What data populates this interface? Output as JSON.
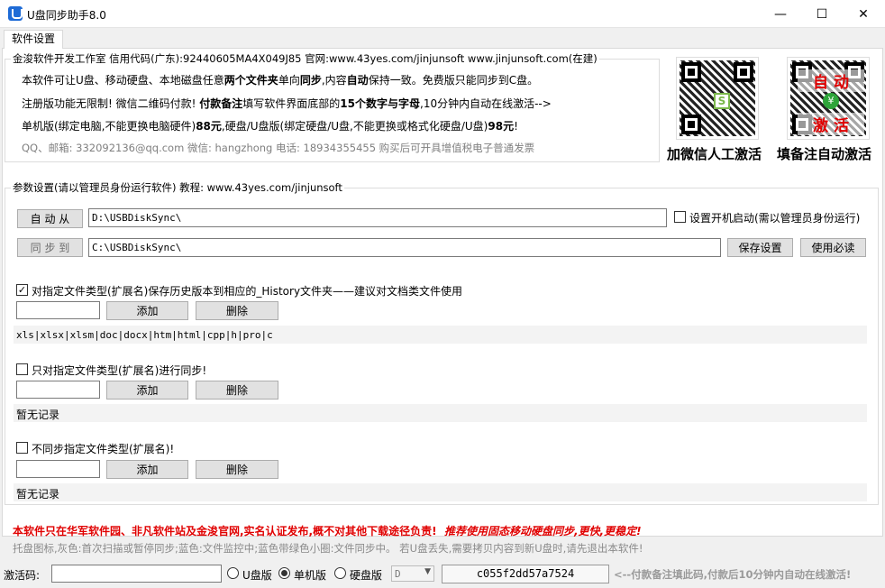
{
  "window": {
    "title": "U盘同步助手8.0",
    "minimize_glyph": "—",
    "maximize_glyph": "☐",
    "close_glyph": "✕"
  },
  "tabs": [
    {
      "label": "软件设置"
    }
  ],
  "info": {
    "group_title": "金浚软件开发工作室 信用代码(广东):92440605MA4X049J85 官网:www.43yes.com/jinjunsoft  www.jinjunsoft.com(在建)",
    "line1_a": "本软件可让U盘、移动硬盘、本地磁盘任意",
    "line1_b": "两个文件夹",
    "line1_c": "单向",
    "line1_d": "同步",
    "line1_e": ",内容",
    "line1_f": "自动",
    "line1_g": "保持一致。免费版只能同步到C盘。",
    "line2_a": "注册版功能无限制! 微信二维码付款! ",
    "line2_b": "付款备注",
    "line2_c": "填写软件界面底部的",
    "line2_d": "15个数字与字母",
    "line2_e": ",10分钟内自动在线激活-->",
    "line3_a": "单机版(绑定电脑,不能更换电脑硬件)",
    "line3_b": "88元",
    "line3_c": ",硬盘/U盘版(绑定硬盘/U盘,不能更换或格式化硬盘/U盘)",
    "line3_d": "98元",
    "line3_e": "!",
    "contact": "QQ、邮箱: 332092136@qq.com   微信: hangzhong   电话: 18934355455   购买后可开具增值税电子普通发票",
    "qr1_caption": "加微信人工激活",
    "qr2_caption": "填备注自动激活",
    "qr2_text_top": "自 动",
    "qr2_text_bottom": "激 活",
    "qr2_center": "¥"
  },
  "params": {
    "group_title": "参数设置(请以管理员身份运行软件)  教程: www.43yes.com/jinjunsoft",
    "from_button": "自 动 从",
    "from_path": "D:\\USBDiskSync\\",
    "autostart_label": "设置开机启动(需以管理员身份运行)",
    "autostart_checked": false,
    "to_button": "同 步 到",
    "to_path": "C:\\USBDiskSync\\",
    "save_button": "保存设置",
    "help_button": "使用必读",
    "history": {
      "checked": true,
      "label": "对指定文件类型(扩展名)保存历史版本到相应的_History文件夹——建议对文档类文件使用",
      "input_value": "",
      "add": "添加",
      "delete": "删除",
      "list": "xls|xlsx|xlsm|doc|docx|htm|html|cpp|h|pro|c"
    },
    "only": {
      "checked": false,
      "label": "只对指定文件类型(扩展名)进行同步!",
      "input_value": "",
      "add": "添加",
      "delete": "删除",
      "list": "暂无记录"
    },
    "exclude": {
      "checked": false,
      "label": "不同步指定文件类型(扩展名)!",
      "input_value": "",
      "add": "添加",
      "delete": "删除",
      "list": "暂无记录"
    }
  },
  "notice": {
    "line1_a": "本软件只在华军软件园、非凡软件站及金浚官网,实名认证发布,概不对其他下载途径负责!",
    "line1_b": "推荐使用固态移动硬盘同步,更快,更稳定!",
    "line2": "托盘图标,灰色:首次扫描或暂停同步;蓝色:文件监控中;蓝色带绿色小圈:文件同步中。  若U盘丢失,需要拷贝内容到新U盘时,请先退出本软件!"
  },
  "bottom": {
    "code_label": "激活码:",
    "code_value": "",
    "radio_udisk": "U盘版",
    "radio_single": "单机版",
    "radio_hdd": "硬盘版",
    "selected": "单机版",
    "drive_value": "D",
    "machine_code": "c055f2dd57a7524",
    "hint": "<--付款备注填此码,付款后10分钟内自动在线激活!"
  },
  "colors": {
    "accent_red": "#e00000",
    "window_bg": "#f0f0f0",
    "panel_bg": "#ffffff",
    "icon_blue": "#1e6bd6"
  }
}
